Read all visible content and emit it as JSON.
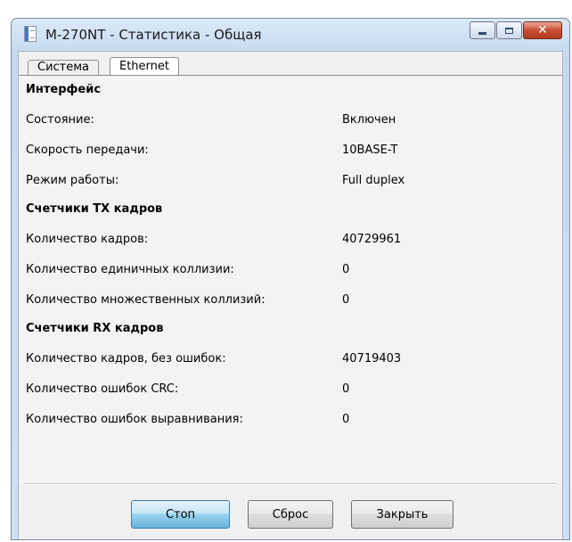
{
  "window": {
    "title": "M-270NT - Статистика - Общая",
    "close_glyph": "✕"
  },
  "tabs": [
    {
      "label": "Система",
      "active": false
    },
    {
      "label": "Ethernet",
      "active": true
    }
  ],
  "sections": {
    "interface": {
      "heading": "Интерфейс",
      "rows": [
        {
          "label": "Состояние:",
          "value": "Включен"
        },
        {
          "label": "Скорость передачи:",
          "value": "10BASE-T"
        },
        {
          "label": "Режим работы:",
          "value": "Full duplex"
        }
      ]
    },
    "tx": {
      "heading": "Счетчики TX кадров",
      "rows": [
        {
          "label": "Количество кадров:",
          "value": "40729961"
        },
        {
          "label": "Количество единичных коллизии:",
          "value": "0"
        },
        {
          "label": "Количество множественных коллизий:",
          "value": "0"
        }
      ]
    },
    "rx": {
      "heading": "Счетчики RX кадров",
      "rows": [
        {
          "label": "Количество кадров, без ошибок:",
          "value": "40719403"
        },
        {
          "label": "Количество ошибок CRC:",
          "value": "0"
        },
        {
          "label": "Количество ошибок выравнивания:",
          "value": "0"
        }
      ]
    }
  },
  "buttons": {
    "stop": "Стоп",
    "reset": "Сброс",
    "close": "Закрыть"
  },
  "colors": {
    "titlebar": "#c5daf0",
    "close_button": "#c84d33",
    "primary_button": "#98d1ef"
  }
}
